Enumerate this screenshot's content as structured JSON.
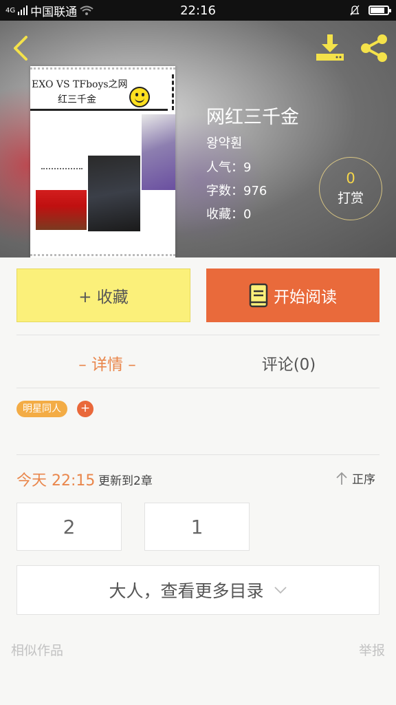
{
  "status_bar": {
    "network": "4G",
    "carrier": "中国联通",
    "time": "22:16",
    "battery_level": 0.85,
    "icons": [
      "signal-icon",
      "wifi-icon",
      "silent-icon",
      "battery-icon"
    ]
  },
  "header": {
    "book_title": "网红三千金",
    "author": "왕약훤",
    "popularity": "人气：9",
    "word_count": "字数：976",
    "favorites": "收藏：0",
    "reward": {
      "count": "0",
      "label": "打赏"
    },
    "cover": {
      "line1": "EXO VS TFboys之网",
      "line2": "红三千金"
    }
  },
  "actions": {
    "favorite_label": "+ 收藏",
    "read_label": "开始阅读"
  },
  "tabs": [
    {
      "label": "– 详情 –",
      "active": true
    },
    {
      "label": "评论(0)",
      "active": false
    }
  ],
  "tags": [
    {
      "label": "明星同人"
    }
  ],
  "tag_add_label": "+",
  "updates": {
    "time": "今天 22:15",
    "text": "更新到2章",
    "sort_label": "正序"
  },
  "chapters": [
    "2",
    "1"
  ],
  "more_toc_label": "大人，查看更多目录",
  "footer": {
    "similar_label": "相似作品",
    "report_label": "举报"
  },
  "colors": {
    "accent_orange": "#e96a3b",
    "favorite_yellow": "#fbf07a",
    "icon_yellow": "#f4e24a",
    "tab_active": "#e9864b"
  }
}
